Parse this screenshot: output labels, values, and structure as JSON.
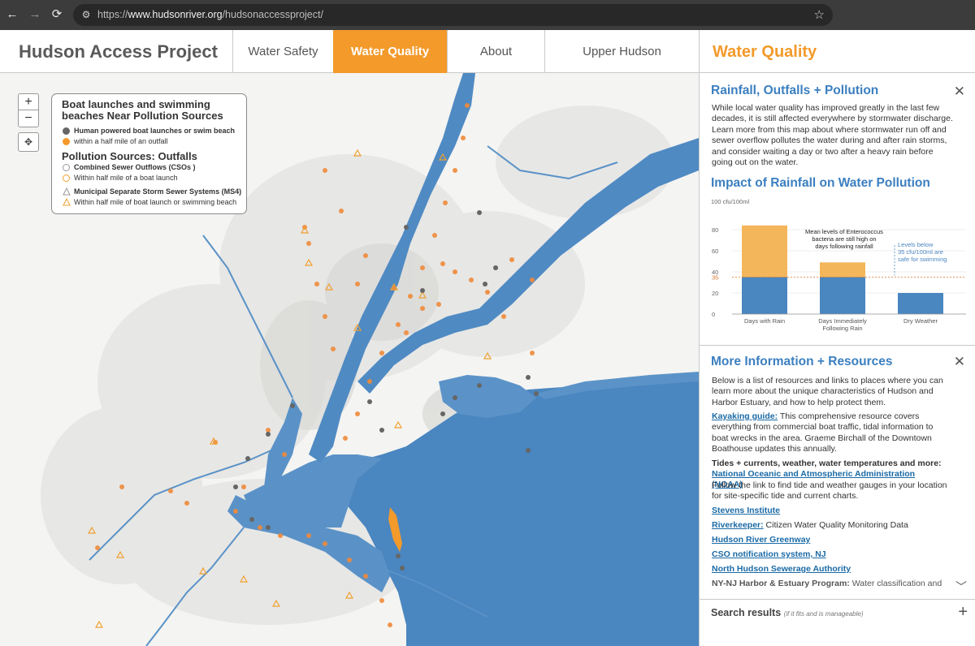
{
  "browser": {
    "url_prefix": "https://",
    "url_host": "www.hudsonriver.org",
    "url_path": "/hudsonaccessproject/"
  },
  "site": {
    "title": "Hudson Access Project",
    "nav": [
      {
        "label": "Water Safety",
        "active": false
      },
      {
        "label": "Water Quality",
        "active": true
      },
      {
        "label": "About",
        "active": false
      },
      {
        "label": "Upper Hudson",
        "active": false
      }
    ],
    "accent_color": "#f39a2b",
    "water_color": "#4a86c0"
  },
  "map": {
    "zoom_in": "+",
    "zoom_out": "−",
    "legend": {
      "title": "Boat launches and swimming beaches Near Pollution Sources",
      "launch_label": "Human powered boat launches or swim beach",
      "launch_near_label": "within a half mile of an outfall",
      "outfalls_title": "Pollution Sources: Outfalls",
      "cso_label": "Combined Sewer Outflows (CSOs )",
      "cso_near_label": "Within half mile of a boat launch",
      "ms4_label": "Municipal Separate Storm Sewer Systems (MS4)",
      "ms4_near_label": "Within half mile of boat launch or swimming beach"
    }
  },
  "panel": {
    "title": "Water Quality",
    "rainfall": {
      "title": "Rainfall, Outfalls + Pollution",
      "body": "While local water quality has improved greatly in the last few decades, it is still affected everywhere by stormwater discharge. Learn more from this map about where stormwater run off and sewer overflow pollutes the water during and after rain storms, and consider waiting a day or two after a heavy rain before going out on the water."
    },
    "impact_title": "Impact of Rainfall on Water Pollution",
    "more": {
      "title": "More Information + Resources",
      "intro": "Below is a list of resources and links to places where you can learn more about the unique characteristics of Hudson and Harbor Estuary, and how to help protect them.",
      "kayak_link": "Kayaking guide:",
      "kayak_text": " This comprehensive resource covers everything from commercial boat traffic, tidal information to boat wrecks in the area. Graeme Birchall of the Downtown Boathouse updates this annually.",
      "tides_heading": "Tides + currents, weather, water temperatures and more:",
      "noaa_link": "National Oceanic and Atmospheric Administration (NOAA)",
      "noaa_text": "Follow the link to find tide and weather gauges in your location for site-specific tide and current charts.",
      "stevens_link": "Stevens Institute",
      "riverkeeper_link": "Riverkeeper:",
      "riverkeeper_text": " Citizen Water Quality Monitoring Data",
      "greenway_link": "Hudson River Greenway",
      "cso_link": "CSO notification system, NJ",
      "nhsa_link": "North Hudson Sewerage Authority",
      "harbor_link": "NY-NJ Harbor & Estuary Program:",
      "harbor_text": " Water classification and"
    },
    "search": {
      "label": "Search results",
      "note": "(if it fits and is manageable)"
    }
  },
  "chart_data": {
    "type": "bar",
    "title": "Impact of Rainfall on Water Pollution",
    "ylabel": "100 cfu/100ml",
    "yticks": [
      0,
      20,
      35,
      40,
      60,
      80
    ],
    "ylim": [
      0,
      100
    ],
    "categories": [
      "Days with Rain",
      "Days Immediately Following Rain",
      "Dry Weather"
    ],
    "category_lines": [
      [
        "Days with Rain"
      ],
      [
        "Days Immediately",
        "Following Rain"
      ],
      [
        "Dry Weather"
      ]
    ],
    "series": [
      {
        "name": "",
        "color": "#4a86c0",
        "values": [
          35,
          35,
          20
        ]
      },
      {
        "name": "",
        "color": "#f4b65a",
        "values": [
          49,
          14,
          0
        ]
      }
    ],
    "threshold": 35,
    "threshold_color": "#d8742b",
    "annotations": [
      {
        "lines": [
          "Mean levels of Enterococcus",
          "bacteria are still high on",
          "days following rainfall"
        ]
      },
      {
        "lines": [
          "Levels below",
          "35 cfu/100ml are",
          "safe for swimming"
        ],
        "color": "#4a86c0"
      }
    ]
  }
}
